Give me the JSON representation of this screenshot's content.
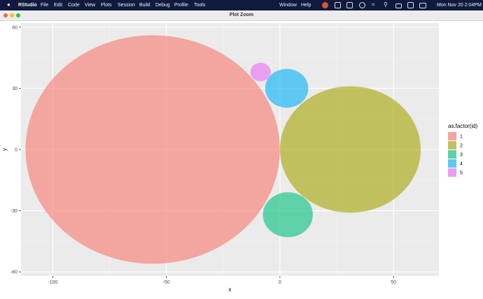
{
  "menubar": {
    "app": "RStudio",
    "items": [
      "File",
      "Edit",
      "Code",
      "View",
      "Plots",
      "Session",
      "Build",
      "Debug",
      "Profile",
      "Tools"
    ],
    "right_items": [
      "Window",
      "Help"
    ],
    "clock": "Mon Nov 20  2:04PM"
  },
  "window": {
    "title": "Plot Zoom"
  },
  "chart_data": {
    "type": "scatter",
    "title": "",
    "xlabel": "x",
    "ylabel": "y",
    "xlim": [
      -114,
      70
    ],
    "ylim": [
      -62,
      62
    ],
    "x_ticks": [
      -100,
      -50,
      0,
      50
    ],
    "y_ticks": [
      -60,
      -30,
      0,
      30,
      60
    ],
    "grid": true,
    "background": "#ebebeb",
    "legend": {
      "title": "as.factor(id)",
      "position": "right",
      "labels": [
        "1",
        "2",
        "3",
        "4",
        "5"
      ]
    },
    "series": [
      {
        "name": "1",
        "x": -56.0,
        "y": 0.0,
        "r": 56.0,
        "color": "#f8766d"
      },
      {
        "name": "2",
        "x": 31.0,
        "y": 0.0,
        "r": 31.0,
        "color": "#a3a500"
      },
      {
        "name": "3",
        "x": 3.5,
        "y": -32.0,
        "r": 11.0,
        "color": "#00bf7d"
      },
      {
        "name": "4",
        "x": 3.0,
        "y": 30.0,
        "r": 9.5,
        "color": "#00b0f6"
      },
      {
        "name": "5",
        "x": -8.5,
        "y": 38.0,
        "r": 4.5,
        "color": "#e76bf3"
      }
    ]
  }
}
